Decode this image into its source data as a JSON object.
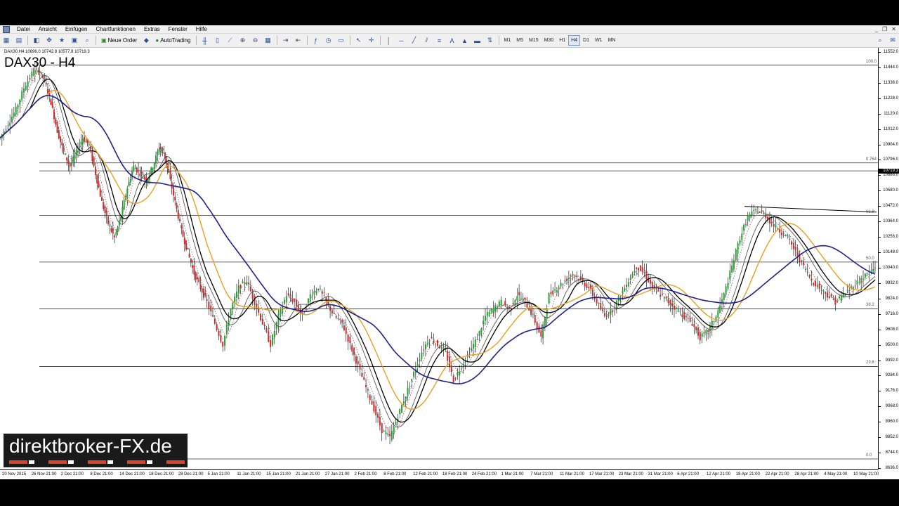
{
  "menu": {
    "items": [
      "Datei",
      "Ansicht",
      "Einfügen",
      "Chartfunktionen",
      "Extras",
      "Fenster",
      "Hilfe"
    ]
  },
  "window_controls": [
    "_",
    "❐",
    "✕"
  ],
  "toolbar": {
    "new_order_label": "Neue Order",
    "autotrading_label": "AutoTrading",
    "timeframes": [
      "M1",
      "M5",
      "M15",
      "M30",
      "H1",
      "H4",
      "D1",
      "W1",
      "MN"
    ],
    "active_timeframe": "H4"
  },
  "chart": {
    "ohlc_text": "DAX30,H4  10696.0 10742.8 10577.8 10719.3",
    "title": "DAX30 - H4",
    "current_price_label": "10719.3",
    "price_labels": [
      "11552.0",
      "11444.0",
      "11336.0",
      "11228.0",
      "11120.0",
      "11012.0",
      "10904.0",
      "10796.0",
      "10688.0",
      "10580.0",
      "10472.0",
      "10364.0",
      "10256.0",
      "10148.0",
      "10040.0",
      "9932.0",
      "9824.0",
      "9716.0",
      "9608.0",
      "9500.0",
      "9392.0",
      "9284.0",
      "9176.0",
      "9068.0",
      "8960.0",
      "8852.0",
      "8744.0",
      "8636.0"
    ],
    "time_labels": [
      "20 Nov 2015",
      "26 Nov 21:00",
      "2 Dec 21:00",
      "8 Dec 21:00",
      "14 Dec 21:00",
      "18 Dec 21:00",
      "28 Dec 21:00",
      "5 Jan 21:00",
      "11 Jan 21:00",
      "15 Jan 21:00",
      "21 Jan 21:00",
      "27 Jan 21:00",
      "2 Feb 21:00",
      "8 Feb 21:00",
      "12 Feb 21:00",
      "18 Feb 21:00",
      "24 Feb 21:00",
      "1 Mar 21:00",
      "7 Mar 21:00",
      "11 Mar 21:00",
      "17 Mar 21:00",
      "23 Mar 21:00",
      "31 Mar 21:00",
      "6 Apr 21:00",
      "12 Apr 21:00",
      "18 Apr 21:00",
      "22 Apr 21:00",
      "28 Apr 21:00",
      "4 May 21:00",
      "10 May 21:00"
    ],
    "fib_levels": [
      {
        "label": "100.0",
        "price": 11460
      },
      {
        "label": "0.764",
        "price": 10775
      },
      {
        "label": "",
        "price": 10719
      },
      {
        "label": "61.8",
        "price": 10406
      },
      {
        "label": "50.0",
        "price": 10080
      },
      {
        "label": "38.2",
        "price": 9752
      },
      {
        "label": "23.6",
        "price": 9348
      },
      {
        "label": "0.0",
        "price": 8700
      }
    ],
    "price_min": 8636,
    "price_max": 11552,
    "colors": {
      "bull": "#2ca02c",
      "bear": "#d62728",
      "wick": "#000000",
      "ma_slow": "#1f1f8f",
      "ma_orange": "#e8a020",
      "ma_black": "#000000",
      "ma_gray": "#555555",
      "ma_red_dotted": "#c04040",
      "ma_cyan_dotted": "#40b0b0",
      "fib_line": "#333333",
      "trendline": "#000000"
    },
    "price_path": [
      [
        0,
        10950
      ],
      [
        10,
        11050
      ],
      [
        20,
        11150
      ],
      [
        30,
        11300
      ],
      [
        40,
        11400
      ],
      [
        48,
        11430
      ],
      [
        56,
        11350
      ],
      [
        64,
        11200
      ],
      [
        72,
        11000
      ],
      [
        80,
        10850
      ],
      [
        88,
        10750
      ],
      [
        96,
        10850
      ],
      [
        104,
        10950
      ],
      [
        112,
        10900
      ],
      [
        120,
        10700
      ],
      [
        128,
        10500
      ],
      [
        136,
        10350
      ],
      [
        144,
        10250
      ],
      [
        152,
        10400
      ],
      [
        160,
        10600
      ],
      [
        168,
        10750
      ],
      [
        176,
        10700
      ],
      [
        184,
        10650
      ],
      [
        192,
        10750
      ],
      [
        200,
        10880
      ],
      [
        206,
        10850
      ],
      [
        212,
        10700
      ],
      [
        220,
        10500
      ],
      [
        228,
        10300
      ],
      [
        236,
        10150
      ],
      [
        244,
        10000
      ],
      [
        252,
        9900
      ],
      [
        260,
        9800
      ],
      [
        270,
        9650
      ],
      [
        280,
        9500
      ],
      [
        290,
        9750
      ],
      [
        300,
        9900
      ],
      [
        310,
        9950
      ],
      [
        320,
        9800
      ],
      [
        330,
        9650
      ],
      [
        340,
        9500
      ],
      [
        350,
        9700
      ],
      [
        360,
        9850
      ],
      [
        370,
        9800
      ],
      [
        380,
        9700
      ],
      [
        390,
        9850
      ],
      [
        400,
        9900
      ],
      [
        410,
        9800
      ],
      [
        420,
        9700
      ],
      [
        430,
        9650
      ],
      [
        440,
        9500
      ],
      [
        450,
        9350
      ],
      [
        460,
        9200
      ],
      [
        470,
        9050
      ],
      [
        480,
        8900
      ],
      [
        490,
        8850
      ],
      [
        500,
        9000
      ],
      [
        510,
        9150
      ],
      [
        520,
        9300
      ],
      [
        530,
        9450
      ],
      [
        540,
        9550
      ],
      [
        550,
        9500
      ],
      [
        560,
        9450
      ],
      [
        570,
        9250
      ],
      [
        580,
        9350
      ],
      [
        590,
        9450
      ],
      [
        600,
        9550
      ],
      [
        610,
        9700
      ],
      [
        620,
        9750
      ],
      [
        630,
        9800
      ],
      [
        640,
        9750
      ],
      [
        650,
        9850
      ],
      [
        660,
        9800
      ],
      [
        670,
        9700
      ],
      [
        680,
        9550
      ],
      [
        690,
        9850
      ],
      [
        700,
        9900
      ],
      [
        710,
        9950
      ],
      [
        720,
        10000
      ],
      [
        730,
        9950
      ],
      [
        740,
        9900
      ],
      [
        750,
        9800
      ],
      [
        760,
        9700
      ],
      [
        770,
        9750
      ],
      [
        780,
        9850
      ],
      [
        790,
        9950
      ],
      [
        800,
        10050
      ],
      [
        810,
        10000
      ],
      [
        820,
        9900
      ],
      [
        830,
        9850
      ],
      [
        840,
        9800
      ],
      [
        850,
        9750
      ],
      [
        860,
        9700
      ],
      [
        870,
        9650
      ],
      [
        880,
        9550
      ],
      [
        890,
        9600
      ],
      [
        900,
        9700
      ],
      [
        910,
        9850
      ],
      [
        920,
        10050
      ],
      [
        930,
        10250
      ],
      [
        940,
        10400
      ],
      [
        950,
        10440
      ],
      [
        960,
        10420
      ],
      [
        970,
        10350
      ],
      [
        980,
        10300
      ],
      [
        990,
        10250
      ],
      [
        1000,
        10150
      ],
      [
        1010,
        10050
      ],
      [
        1020,
        9950
      ],
      [
        1030,
        9900
      ],
      [
        1040,
        9850
      ],
      [
        1050,
        9800
      ],
      [
        1060,
        9850
      ],
      [
        1070,
        9900
      ],
      [
        1080,
        9950
      ],
      [
        1090,
        10000
      ],
      [
        1100,
        10040
      ]
    ],
    "trendline": [
      [
        1060,
        10470
      ],
      [
        1248,
        10430
      ]
    ]
  },
  "watermark": {
    "text": "direktbroker-FX.de",
    "bar_colors": [
      "#d9442a",
      "#ffffff",
      "#d9442a",
      "#ffffff",
      "#d9442a",
      "#ffffff",
      "#d9442a",
      "#ffffff",
      "#d9442a"
    ]
  }
}
